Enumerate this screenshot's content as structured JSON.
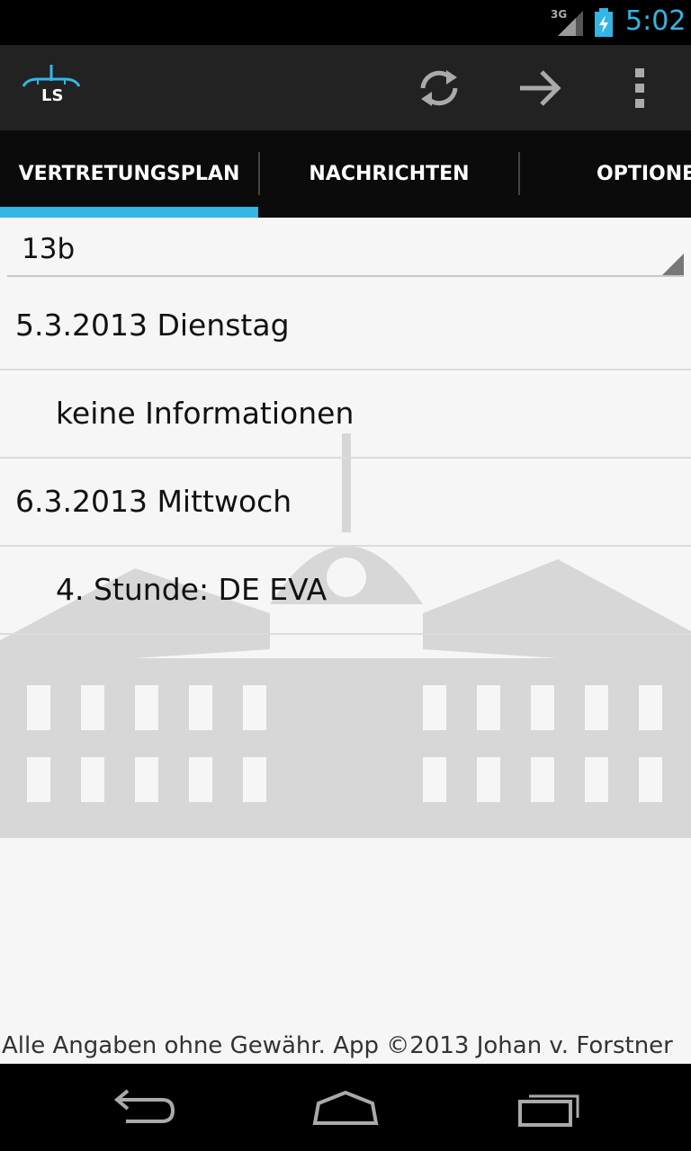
{
  "status_bar": {
    "network": "3G",
    "time": "5:02",
    "icons": [
      "signal-icon",
      "battery-charging-icon"
    ],
    "accent_color": "#33b5e5"
  },
  "action_bar": {
    "logo_text": "LS",
    "actions": [
      "refresh-icon",
      "forward-arrow-icon",
      "overflow-menu-icon"
    ]
  },
  "tabs": [
    {
      "label": "VERTRETUNGSPLAN",
      "selected": true
    },
    {
      "label": "NACHRICHTEN",
      "selected": false
    },
    {
      "label": "OPTIONEN",
      "selected": false
    }
  ],
  "class_selector": {
    "value": "13b"
  },
  "entries": [
    {
      "text": "5.3.2013 Dienstag",
      "kind": "date"
    },
    {
      "text": "keine Informationen",
      "kind": "info"
    },
    {
      "text": "6.3.2013 Mittwoch",
      "kind": "date"
    },
    {
      "text": "4. Stunde: DE EVA",
      "kind": "info"
    }
  ],
  "footer": "Alle Angaben ohne Gewähr. App ©2013 Johan v. Forstner",
  "nav_bar": [
    "back-icon",
    "home-icon",
    "recent-apps-icon"
  ]
}
